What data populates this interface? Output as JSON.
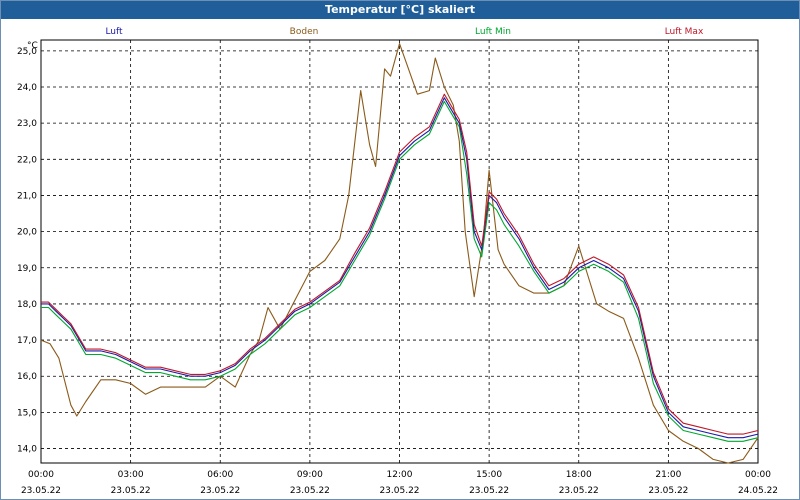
{
  "window": {
    "title": "Temperatur [°C] skaliert"
  },
  "chart_data": {
    "type": "line",
    "title": "Temperatur [°C] skaliert",
    "ylabel": "°C",
    "ylim": [
      13.6,
      25.3
    ],
    "yticks": [
      "14,0",
      "15,0",
      "16,0",
      "17,0",
      "18,0",
      "19,0",
      "20,0",
      "21,0",
      "22,0",
      "23,0",
      "24,0",
      "25,0"
    ],
    "xlim_hours": [
      0,
      24
    ],
    "xticks": [
      {
        "time": "00:00",
        "date": "23.05.22"
      },
      {
        "time": "03:00",
        "date": "23.05.22"
      },
      {
        "time": "06:00",
        "date": "23.05.22"
      },
      {
        "time": "09:00",
        "date": "23.05.22"
      },
      {
        "time": "12:00",
        "date": "23.05.22"
      },
      {
        "time": "15:00",
        "date": "23.05.22"
      },
      {
        "time": "18:00",
        "date": "23.05.22"
      },
      {
        "time": "21:00",
        "date": "23.05.22"
      },
      {
        "time": "00:00",
        "date": "24.05.22"
      }
    ],
    "grid": true,
    "legend_position": "top",
    "series": [
      {
        "name": "Luft",
        "color": "#1a1aa8",
        "x": [
          0,
          0.25,
          0.5,
          0.75,
          1,
          1.5,
          2,
          2.5,
          3,
          3.5,
          4,
          4.5,
          5,
          5.5,
          6,
          6.5,
          7,
          7.5,
          8,
          8.5,
          9,
          9.5,
          10,
          10.5,
          11,
          11.5,
          12,
          12.5,
          13,
          13.5,
          14,
          14.25,
          14.5,
          14.75,
          15,
          15.25,
          15.5,
          16,
          16.5,
          17,
          17.5,
          18,
          18.5,
          19,
          19.5,
          20,
          20.5,
          21,
          21.5,
          22,
          22.5,
          23,
          23.5,
          24
        ],
        "y": [
          18.0,
          18.0,
          17.8,
          17.6,
          17.4,
          16.7,
          16.7,
          16.6,
          16.4,
          16.2,
          16.2,
          16.1,
          16.0,
          16.0,
          16.1,
          16.3,
          16.7,
          17.0,
          17.4,
          17.8,
          18.0,
          18.3,
          18.6,
          19.3,
          20.0,
          21.0,
          22.1,
          22.5,
          22.8,
          23.7,
          23.0,
          22.0,
          20.0,
          19.5,
          21.0,
          20.8,
          20.4,
          19.8,
          19.0,
          18.4,
          18.6,
          19.0,
          19.2,
          19.0,
          18.7,
          17.8,
          16.0,
          15.0,
          14.6,
          14.5,
          14.4,
          14.3,
          14.3,
          14.4
        ]
      },
      {
        "name": "Boden",
        "color": "#8b5a1a",
        "x": [
          0,
          0.3,
          0.6,
          1,
          1.2,
          1.5,
          2,
          2.5,
          3,
          3.5,
          4,
          4.5,
          5,
          5.5,
          6,
          6.5,
          7,
          7.3,
          7.6,
          8,
          8.5,
          9,
          9.5,
          10,
          10.3,
          10.7,
          11,
          11.2,
          11.5,
          11.7,
          12,
          12.3,
          12.6,
          13,
          13.2,
          13.5,
          13.8,
          14,
          14.2,
          14.5,
          14.8,
          15,
          15.3,
          15.5,
          16,
          16.5,
          17,
          17.5,
          18,
          18.3,
          18.6,
          19,
          19.5,
          20,
          20.5,
          21,
          21.5,
          22,
          22.5,
          23,
          23.5,
          24
        ],
        "y": [
          17.0,
          16.9,
          16.5,
          15.2,
          14.9,
          15.3,
          15.9,
          15.9,
          15.8,
          15.5,
          15.7,
          15.7,
          15.7,
          15.7,
          16.0,
          15.7,
          16.6,
          17.0,
          17.9,
          17.3,
          18.1,
          18.9,
          19.2,
          19.8,
          21.0,
          23.9,
          22.4,
          21.8,
          24.5,
          24.3,
          25.2,
          24.5,
          23.8,
          23.9,
          24.8,
          24.0,
          23.5,
          22.5,
          20.0,
          18.2,
          19.8,
          21.7,
          19.5,
          19.1,
          18.5,
          18.3,
          18.3,
          18.5,
          19.6,
          18.8,
          18.0,
          17.8,
          17.6,
          16.5,
          15.2,
          14.5,
          14.2,
          14.0,
          13.7,
          13.6,
          13.7,
          14.3
        ]
      },
      {
        "name": "Luft Min",
        "color": "#00a830",
        "x": [
          0,
          0.25,
          0.5,
          0.75,
          1,
          1.5,
          2,
          2.5,
          3,
          3.5,
          4,
          4.5,
          5,
          5.5,
          6,
          6.5,
          7,
          7.5,
          8,
          8.5,
          9,
          9.5,
          10,
          10.5,
          11,
          11.5,
          12,
          12.5,
          13,
          13.5,
          14,
          14.25,
          14.5,
          14.75,
          15,
          15.25,
          15.5,
          16,
          16.5,
          17,
          17.5,
          18,
          18.5,
          19,
          19.5,
          20,
          20.5,
          21,
          21.5,
          22,
          22.5,
          23,
          23.5,
          24
        ],
        "y": [
          17.9,
          17.9,
          17.7,
          17.5,
          17.3,
          16.6,
          16.6,
          16.5,
          16.3,
          16.1,
          16.1,
          16.0,
          15.9,
          15.9,
          16.0,
          16.2,
          16.6,
          16.9,
          17.3,
          17.7,
          17.9,
          18.2,
          18.5,
          19.2,
          19.9,
          20.9,
          22.0,
          22.4,
          22.7,
          23.6,
          22.9,
          21.6,
          19.8,
          19.3,
          20.8,
          20.6,
          20.2,
          19.6,
          18.9,
          18.3,
          18.5,
          18.9,
          19.1,
          18.9,
          18.6,
          17.6,
          15.8,
          14.9,
          14.5,
          14.4,
          14.3,
          14.2,
          14.2,
          14.3
        ]
      },
      {
        "name": "Luft Max",
        "color": "#c01828",
        "x": [
          0,
          0.25,
          0.5,
          0.75,
          1,
          1.5,
          2,
          2.5,
          3,
          3.5,
          4,
          4.5,
          5,
          5.5,
          6,
          6.5,
          7,
          7.5,
          8,
          8.5,
          9,
          9.5,
          10,
          10.5,
          11,
          11.5,
          12,
          12.5,
          13,
          13.5,
          14,
          14.25,
          14.5,
          14.75,
          15,
          15.25,
          15.5,
          16,
          16.5,
          17,
          17.5,
          18,
          18.5,
          19,
          19.5,
          20,
          20.5,
          21,
          21.5,
          22,
          22.5,
          23,
          23.5,
          24
        ],
        "y": [
          18.05,
          18.05,
          17.85,
          17.65,
          17.45,
          16.75,
          16.75,
          16.65,
          16.45,
          16.25,
          16.25,
          16.15,
          16.05,
          16.05,
          16.15,
          16.35,
          16.75,
          17.05,
          17.45,
          17.85,
          18.05,
          18.35,
          18.65,
          19.4,
          20.1,
          21.1,
          22.2,
          22.6,
          22.9,
          23.8,
          23.1,
          22.2,
          20.2,
          19.6,
          21.1,
          20.9,
          20.5,
          19.9,
          19.1,
          18.5,
          18.7,
          19.1,
          19.3,
          19.1,
          18.8,
          17.9,
          16.1,
          15.1,
          14.7,
          14.6,
          14.5,
          14.4,
          14.4,
          14.5
        ]
      }
    ]
  }
}
